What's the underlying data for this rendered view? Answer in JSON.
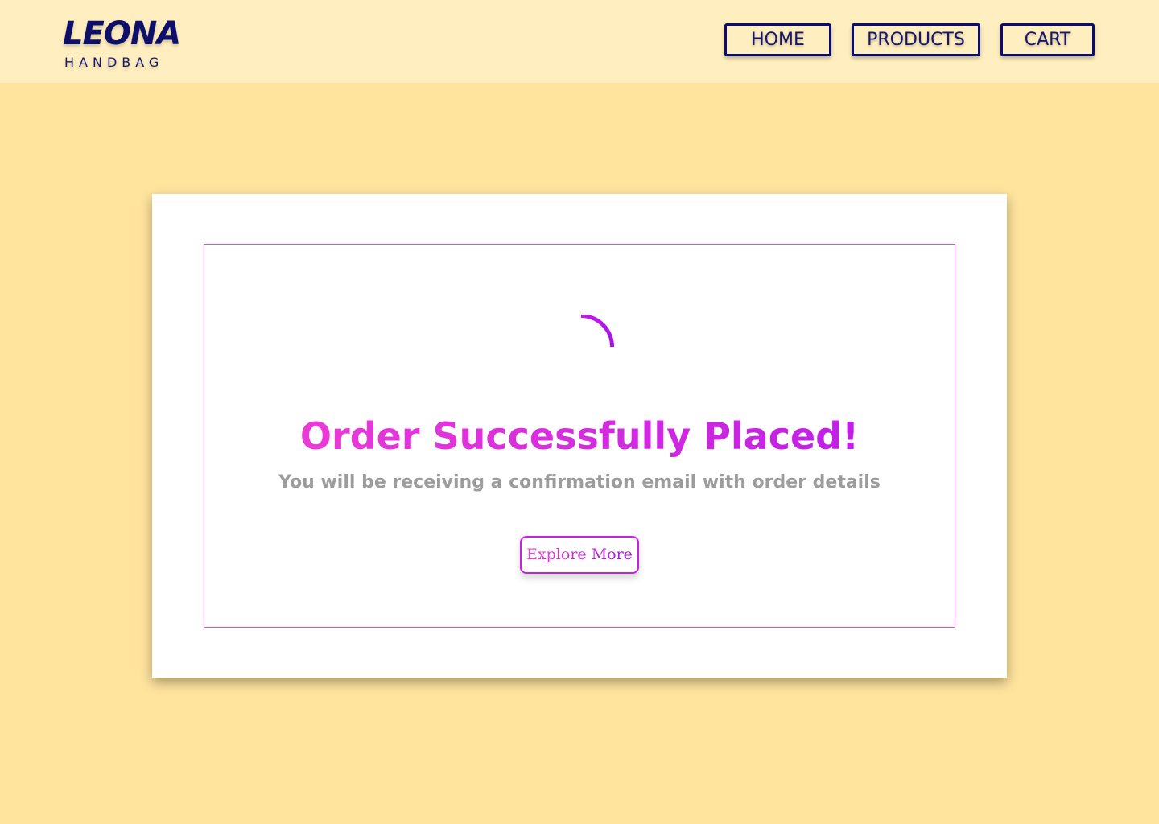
{
  "header": {
    "logo": {
      "name": "LEONA",
      "tagline": "HANDBAG"
    },
    "nav": [
      {
        "label": "HOME"
      },
      {
        "label": "PRODUCTS"
      },
      {
        "label": "CART"
      }
    ]
  },
  "main": {
    "spinner_icon": "loading-spinner-icon",
    "title": "Order Successfully Placed!",
    "subtitle": "You will be receiving a confirmation email with order details",
    "explore_label": "Explore More"
  },
  "colors": {
    "page_bg": "#ffe49e",
    "header_bg": "#ffefc0",
    "nav_border": "#0b0b74",
    "accent_start": "#f23fd3",
    "accent_end": "#b91aea",
    "subtitle": "#9c9c9c"
  }
}
